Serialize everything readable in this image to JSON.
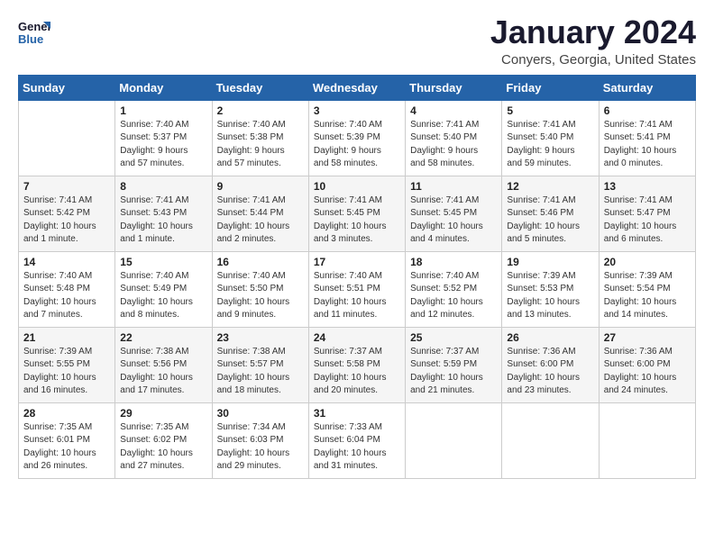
{
  "header": {
    "logo_text_general": "General",
    "logo_text_blue": "Blue",
    "title": "January 2024",
    "subtitle": "Conyers, Georgia, United States"
  },
  "days_of_week": [
    "Sunday",
    "Monday",
    "Tuesday",
    "Wednesday",
    "Thursday",
    "Friday",
    "Saturday"
  ],
  "weeks": [
    [
      {
        "day": "",
        "content": ""
      },
      {
        "day": "1",
        "content": "Sunrise: 7:40 AM\nSunset: 5:37 PM\nDaylight: 9 hours\nand 57 minutes."
      },
      {
        "day": "2",
        "content": "Sunrise: 7:40 AM\nSunset: 5:38 PM\nDaylight: 9 hours\nand 57 minutes."
      },
      {
        "day": "3",
        "content": "Sunrise: 7:40 AM\nSunset: 5:39 PM\nDaylight: 9 hours\nand 58 minutes."
      },
      {
        "day": "4",
        "content": "Sunrise: 7:41 AM\nSunset: 5:40 PM\nDaylight: 9 hours\nand 58 minutes."
      },
      {
        "day": "5",
        "content": "Sunrise: 7:41 AM\nSunset: 5:40 PM\nDaylight: 9 hours\nand 59 minutes."
      },
      {
        "day": "6",
        "content": "Sunrise: 7:41 AM\nSunset: 5:41 PM\nDaylight: 10 hours\nand 0 minutes."
      }
    ],
    [
      {
        "day": "7",
        "content": "Sunrise: 7:41 AM\nSunset: 5:42 PM\nDaylight: 10 hours\nand 1 minute."
      },
      {
        "day": "8",
        "content": "Sunrise: 7:41 AM\nSunset: 5:43 PM\nDaylight: 10 hours\nand 1 minute."
      },
      {
        "day": "9",
        "content": "Sunrise: 7:41 AM\nSunset: 5:44 PM\nDaylight: 10 hours\nand 2 minutes."
      },
      {
        "day": "10",
        "content": "Sunrise: 7:41 AM\nSunset: 5:45 PM\nDaylight: 10 hours\nand 3 minutes."
      },
      {
        "day": "11",
        "content": "Sunrise: 7:41 AM\nSunset: 5:45 PM\nDaylight: 10 hours\nand 4 minutes."
      },
      {
        "day": "12",
        "content": "Sunrise: 7:41 AM\nSunset: 5:46 PM\nDaylight: 10 hours\nand 5 minutes."
      },
      {
        "day": "13",
        "content": "Sunrise: 7:41 AM\nSunset: 5:47 PM\nDaylight: 10 hours\nand 6 minutes."
      }
    ],
    [
      {
        "day": "14",
        "content": "Sunrise: 7:40 AM\nSunset: 5:48 PM\nDaylight: 10 hours\nand 7 minutes."
      },
      {
        "day": "15",
        "content": "Sunrise: 7:40 AM\nSunset: 5:49 PM\nDaylight: 10 hours\nand 8 minutes."
      },
      {
        "day": "16",
        "content": "Sunrise: 7:40 AM\nSunset: 5:50 PM\nDaylight: 10 hours\nand 9 minutes."
      },
      {
        "day": "17",
        "content": "Sunrise: 7:40 AM\nSunset: 5:51 PM\nDaylight: 10 hours\nand 11 minutes."
      },
      {
        "day": "18",
        "content": "Sunrise: 7:40 AM\nSunset: 5:52 PM\nDaylight: 10 hours\nand 12 minutes."
      },
      {
        "day": "19",
        "content": "Sunrise: 7:39 AM\nSunset: 5:53 PM\nDaylight: 10 hours\nand 13 minutes."
      },
      {
        "day": "20",
        "content": "Sunrise: 7:39 AM\nSunset: 5:54 PM\nDaylight: 10 hours\nand 14 minutes."
      }
    ],
    [
      {
        "day": "21",
        "content": "Sunrise: 7:39 AM\nSunset: 5:55 PM\nDaylight: 10 hours\nand 16 minutes."
      },
      {
        "day": "22",
        "content": "Sunrise: 7:38 AM\nSunset: 5:56 PM\nDaylight: 10 hours\nand 17 minutes."
      },
      {
        "day": "23",
        "content": "Sunrise: 7:38 AM\nSunset: 5:57 PM\nDaylight: 10 hours\nand 18 minutes."
      },
      {
        "day": "24",
        "content": "Sunrise: 7:37 AM\nSunset: 5:58 PM\nDaylight: 10 hours\nand 20 minutes."
      },
      {
        "day": "25",
        "content": "Sunrise: 7:37 AM\nSunset: 5:59 PM\nDaylight: 10 hours\nand 21 minutes."
      },
      {
        "day": "26",
        "content": "Sunrise: 7:36 AM\nSunset: 6:00 PM\nDaylight: 10 hours\nand 23 minutes."
      },
      {
        "day": "27",
        "content": "Sunrise: 7:36 AM\nSunset: 6:00 PM\nDaylight: 10 hours\nand 24 minutes."
      }
    ],
    [
      {
        "day": "28",
        "content": "Sunrise: 7:35 AM\nSunset: 6:01 PM\nDaylight: 10 hours\nand 26 minutes."
      },
      {
        "day": "29",
        "content": "Sunrise: 7:35 AM\nSunset: 6:02 PM\nDaylight: 10 hours\nand 27 minutes."
      },
      {
        "day": "30",
        "content": "Sunrise: 7:34 AM\nSunset: 6:03 PM\nDaylight: 10 hours\nand 29 minutes."
      },
      {
        "day": "31",
        "content": "Sunrise: 7:33 AM\nSunset: 6:04 PM\nDaylight: 10 hours\nand 31 minutes."
      },
      {
        "day": "",
        "content": ""
      },
      {
        "day": "",
        "content": ""
      },
      {
        "day": "",
        "content": ""
      }
    ]
  ]
}
